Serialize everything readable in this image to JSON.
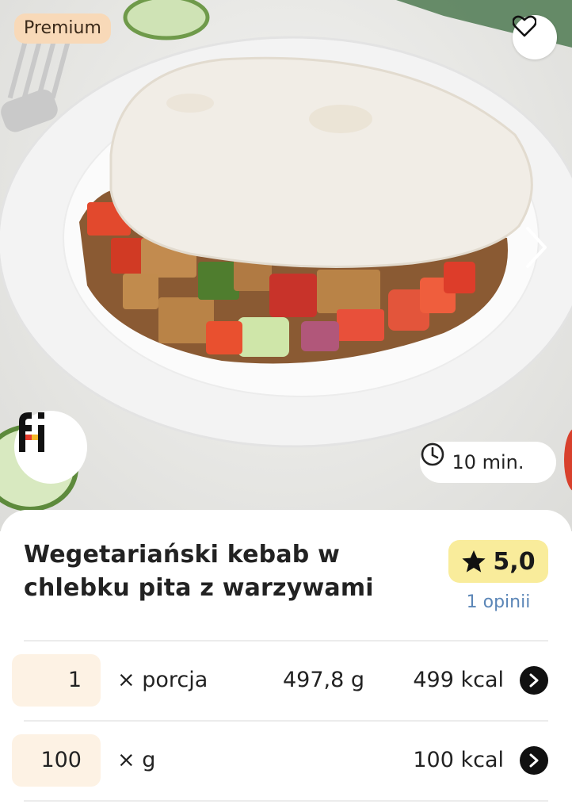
{
  "hero": {
    "premium_label": "Premium",
    "favorite_icon": "heart-outline-icon",
    "next_icon": "chevron-right-icon",
    "brand_icon": "fi-logo-icon",
    "time_icon": "clock-icon",
    "time_label": "10 min."
  },
  "recipe": {
    "title": "Wegetariański kebab w chlebku pita z warzywami",
    "rating": "5,0",
    "rating_icon": "star-icon",
    "reviews_label": "1 opinii"
  },
  "portions": [
    {
      "quantity": "1",
      "unit": "× porcja",
      "weight": "497,8 g",
      "kcal": "499 kcal"
    },
    {
      "quantity": "100",
      "unit": "× g",
      "weight": "",
      "kcal": "100 kcal"
    }
  ],
  "colors": {
    "premium_bg": "#f8d9b8",
    "rating_bg": "#f9ec9b",
    "quantity_bg": "#fdf2e4",
    "reviews_text": "#5b86b7"
  }
}
